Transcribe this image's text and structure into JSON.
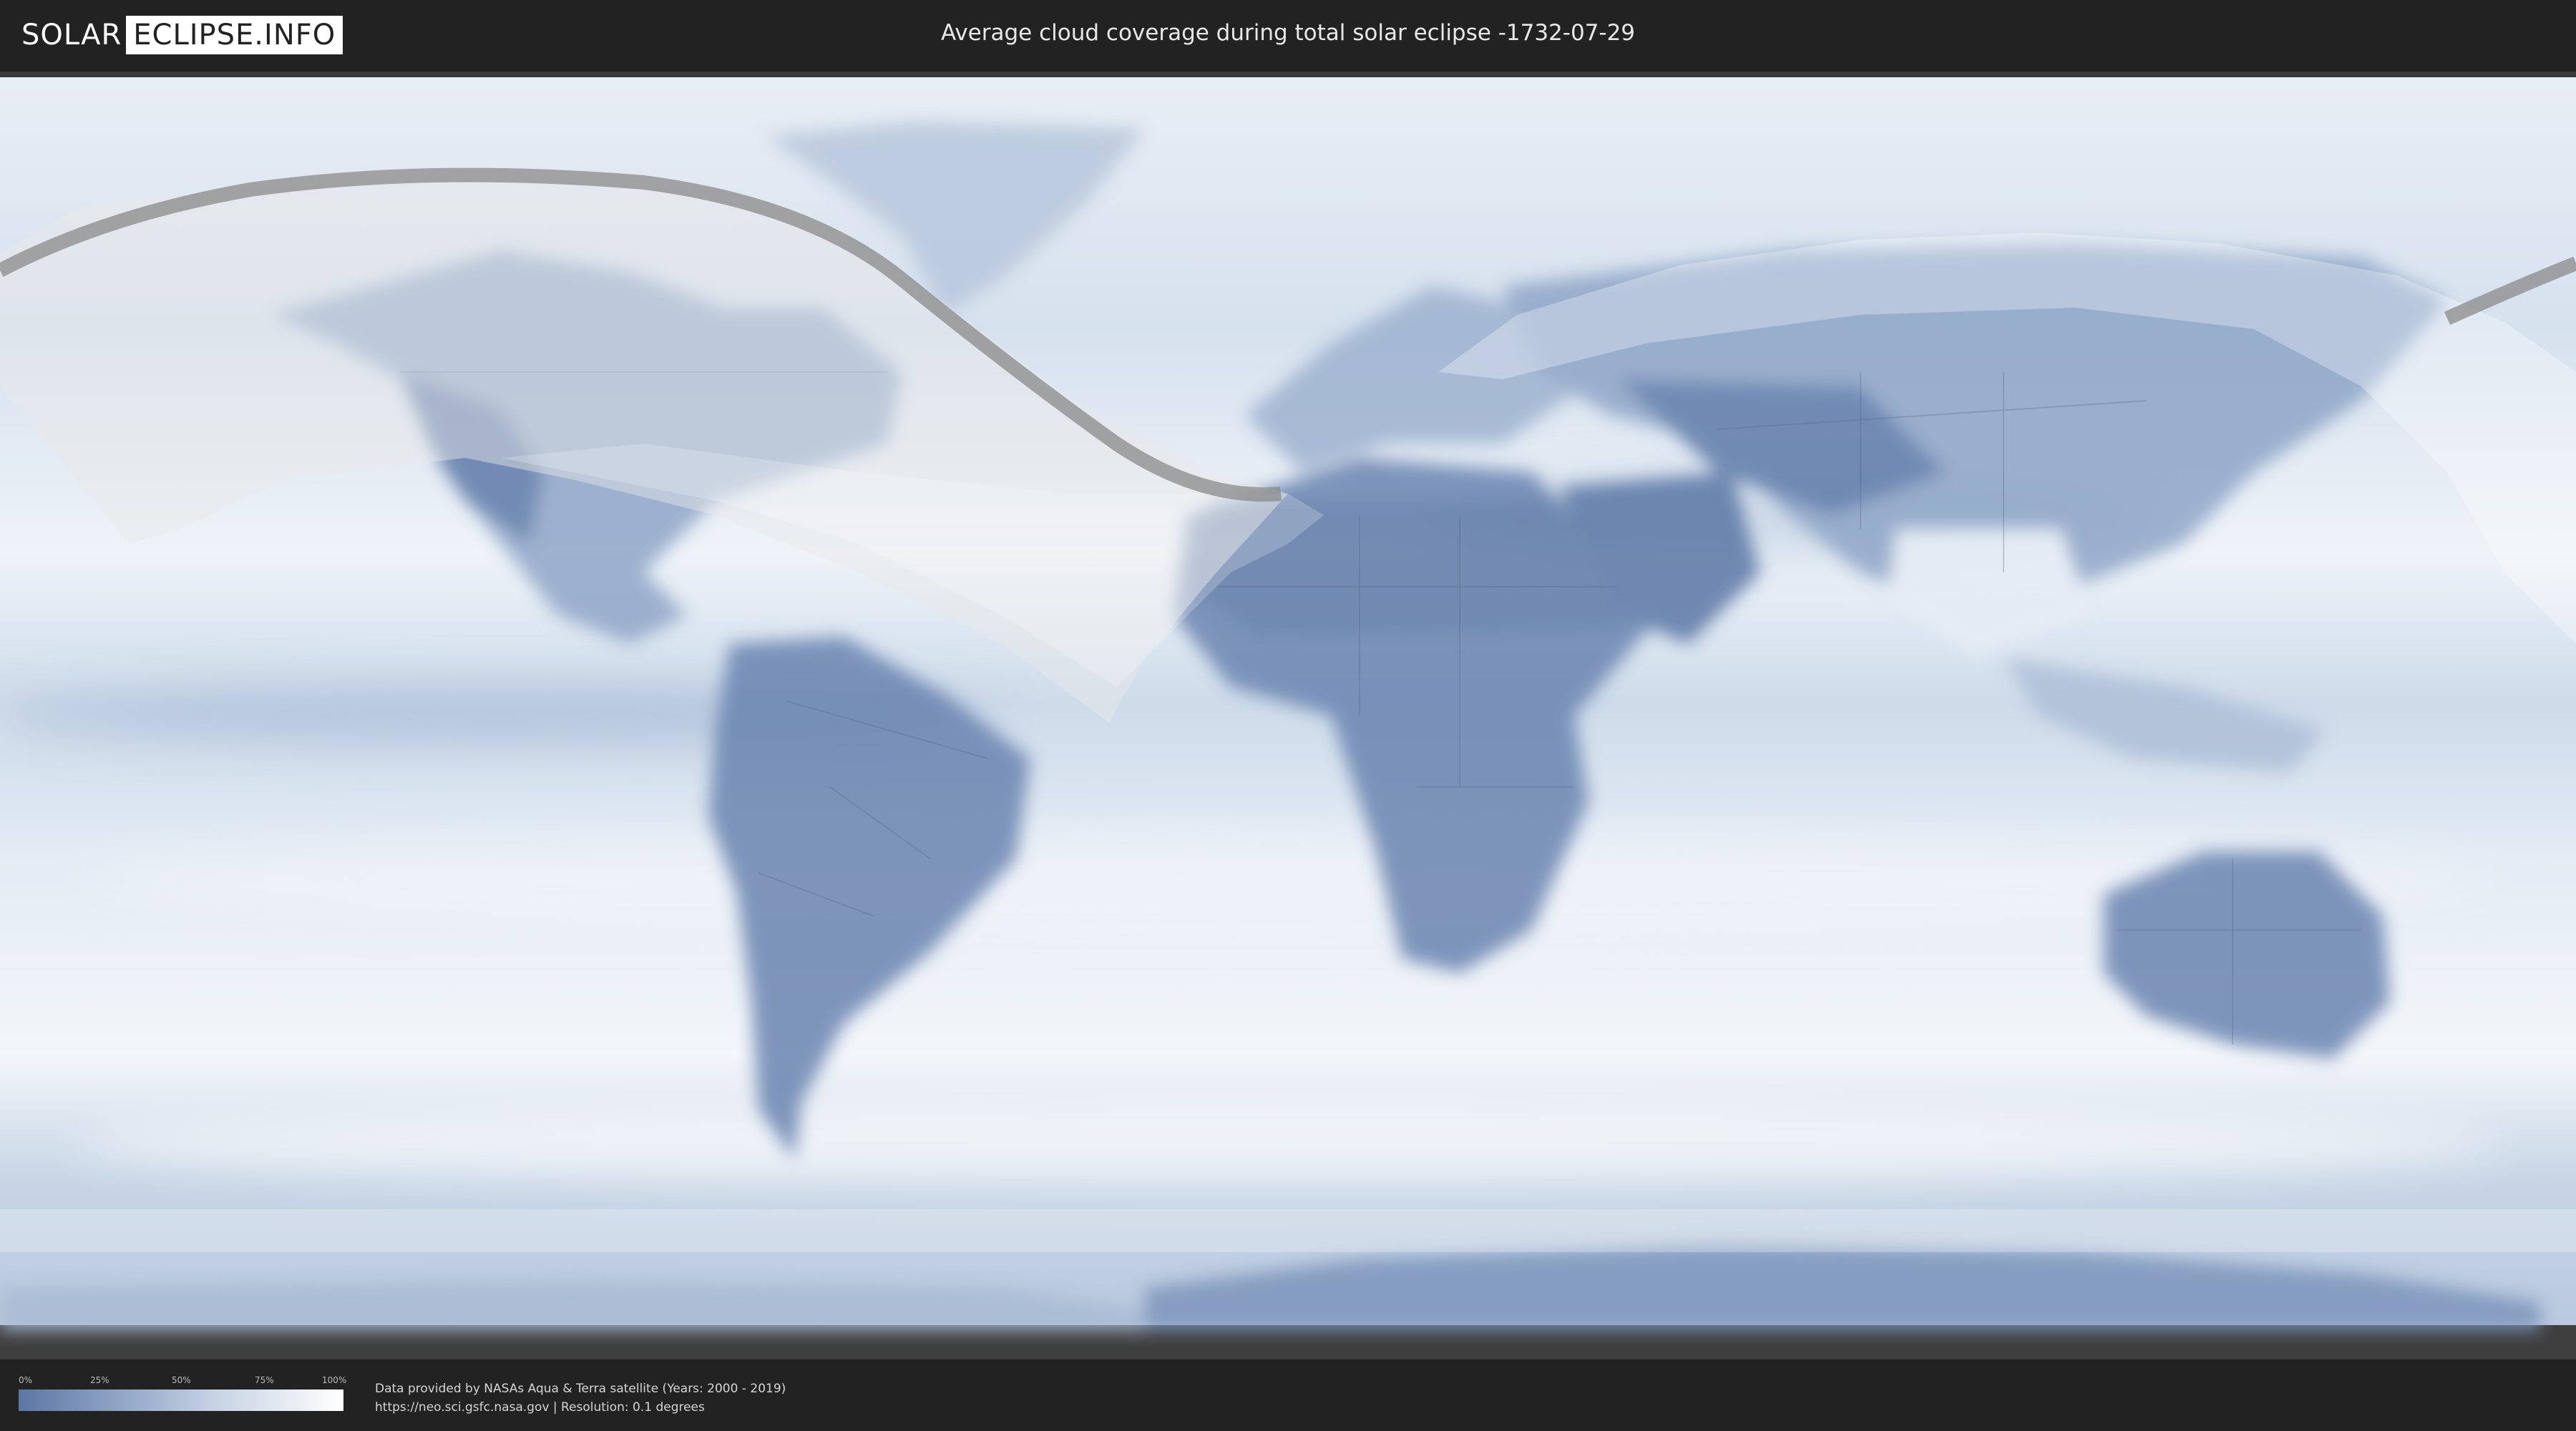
{
  "header": {
    "logo": {
      "part1": "SOLAR",
      "part2": "ECLIPSE.INFO"
    },
    "title": "Average cloud coverage during total solar eclipse -1732-07-29"
  },
  "legend": {
    "ticks": [
      "0%",
      "25%",
      "50%",
      "75%",
      "100%"
    ],
    "colors": {
      "low": "#5d77a3",
      "mid": "#c6d2e3",
      "high": "#ffffff"
    }
  },
  "credits": {
    "line1": "Data provided by NASAs Aqua & Terra satellite (Years: 2000 - 2019)",
    "line2": "https://neo.sci.gsfc.nasa.gov | Resolution: 0.1 degrees"
  },
  "map": {
    "projection": "equirectangular",
    "layers": [
      "cloud-coverage",
      "country-borders",
      "eclipse-visibility-zones",
      "totality-path"
    ]
  },
  "colors": {
    "background": "#222222",
    "ocean_clouds": "#dfe8f2",
    "land_clear": "#6d87b2"
  }
}
